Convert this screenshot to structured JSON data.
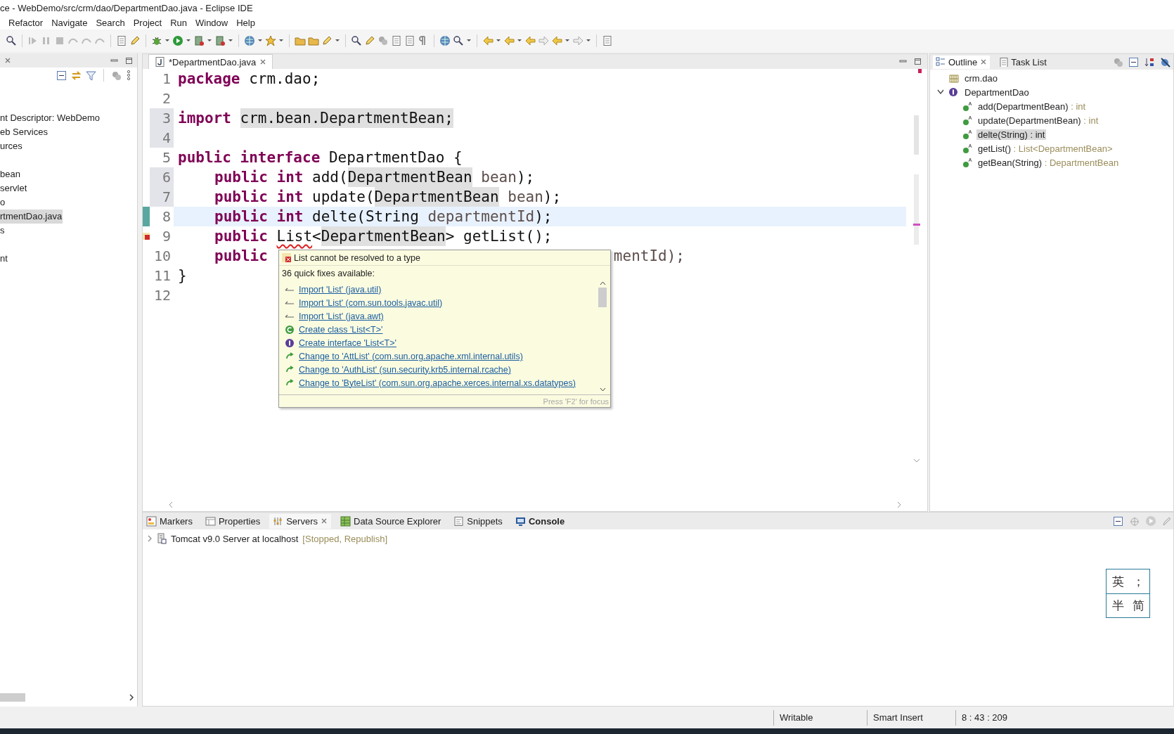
{
  "window": {
    "title": "ce - WebDemo/src/crm/dao/DepartmentDao.java - Eclipse IDE"
  },
  "menu": [
    "Refactor",
    "Navigate",
    "Search",
    "Project",
    "Run",
    "Window",
    "Help"
  ],
  "explorer": {
    "groups": [
      [
        {
          "label": "nt Descriptor: WebDemo",
          "selected": false
        },
        {
          "label": "eb Services",
          "selected": false
        },
        {
          "label": "urces",
          "selected": false
        }
      ],
      [
        {
          "label": "bean",
          "selected": false
        },
        {
          "label": "servlet",
          "selected": false
        },
        {
          "label": "o",
          "selected": false
        },
        {
          "label": "rtmentDao.java",
          "selected": true
        },
        {
          "label": "s",
          "selected": false
        }
      ],
      [
        {
          "label": "nt",
          "selected": false
        }
      ]
    ]
  },
  "editor": {
    "tab": {
      "label": "*DepartmentDao.java",
      "selected": true
    },
    "lines": [
      {
        "number": "1",
        "shaded": false,
        "tokens": [
          {
            "text": "package",
            "kind": "keyword"
          },
          {
            "text": " crm.dao;",
            "kind": "plain"
          }
        ]
      },
      {
        "number": "2",
        "shaded": false
      },
      {
        "number": "3",
        "shaded": true,
        "tokens": [
          {
            "text": "import ",
            "kind": "keyword"
          },
          {
            "text": "crm.bean.DepartmentBean;",
            "kind": "occurrence"
          }
        ]
      },
      {
        "number": "4",
        "shaded": true
      },
      {
        "number": "5",
        "shaded": false,
        "tokens": [
          {
            "text": "public",
            "kind": "keyword"
          },
          {
            "text": " interface",
            "kind": "keyword"
          },
          {
            "text": " DepartmentDao {",
            "kind": "plain"
          }
        ]
      },
      {
        "number": "6",
        "shaded": true,
        "indented": true,
        "tokens": [
          {
            "text": "public",
            "kind": "keyword"
          },
          {
            "text": " int",
            "kind": "keyword"
          },
          {
            "text": " add(",
            "kind": "plain"
          },
          {
            "text": "DepartmentBean",
            "kind": "occurrence"
          },
          {
            "text": " bean",
            "kind": "parameter"
          },
          {
            "text": ");",
            "kind": "plain"
          }
        ]
      },
      {
        "number": "7",
        "shaded": true,
        "indented": true,
        "tokens": [
          {
            "text": "public",
            "kind": "keyword"
          },
          {
            "text": " int",
            "kind": "keyword"
          },
          {
            "text": " update(",
            "kind": "plain"
          },
          {
            "text": "DepartmentBean",
            "kind": "occurrence"
          },
          {
            "text": " bean",
            "kind": "parameter"
          },
          {
            "text": ");",
            "kind": "plain"
          }
        ]
      },
      {
        "number": "8",
        "shaded": false,
        "current": true,
        "marker": {
          "kind": "change"
        },
        "indented": true,
        "tokens": [
          {
            "text": "public",
            "kind": "keyword"
          },
          {
            "text": " int",
            "kind": "keyword"
          },
          {
            "text": " delte(String ",
            "kind": "plain"
          },
          {
            "text": "departmentId",
            "kind": "parameter"
          },
          {
            "text": ");",
            "kind": "plain"
          }
        ]
      },
      {
        "number": "9",
        "shaded": false,
        "marker": {
          "kind": "error"
        },
        "indented": true,
        "tokens": [
          {
            "text": "public ",
            "kind": "keyword"
          },
          {
            "text": "List",
            "kind": "error"
          },
          {
            "text": "<",
            "kind": "plain"
          },
          {
            "text": "DepartmentBean",
            "kind": "occurrence"
          },
          {
            "text": "> getList();",
            "kind": "plain"
          }
        ]
      },
      {
        "number": "10",
        "shaded": false,
        "indented": true,
        "tokens": [
          {
            "text": "public",
            "kind": "keyword"
          },
          {
            "text": "mentId);",
            "kind": "tail"
          }
        ]
      },
      {
        "number": "11",
        "shaded": false,
        "tokens": [
          {
            "text": "}",
            "kind": "plain"
          }
        ]
      },
      {
        "number": "12",
        "shaded": false
      }
    ]
  },
  "quick_fix": {
    "title": "List cannot be resolved to a type",
    "summary": "36 quick fixes available:",
    "fixes": [
      {
        "kind": "import",
        "label": "Import 'List' (java.util)"
      },
      {
        "kind": "import",
        "label": "Import 'List' (com.sun.tools.javac.util)"
      },
      {
        "kind": "import",
        "label": "Import 'List' (java.awt)"
      },
      {
        "kind": "class",
        "label": "Create class 'List<T>'"
      },
      {
        "kind": "interface",
        "label": "Create interface 'List<T>'"
      },
      {
        "kind": "change",
        "label": "Change to 'AttList' (com.sun.org.apache.xml.internal.utils)"
      },
      {
        "kind": "change",
        "label": "Change to 'AuthList' (sun.security.krb5.internal.rcache)"
      },
      {
        "kind": "change",
        "label": "Change to 'ByteList' (com.sun.org.apache.xerces.internal.xs.datatypes)"
      }
    ],
    "footer": "Press 'F2' for focus"
  },
  "outline": {
    "tabs": [
      {
        "label": "Outline",
        "selected": true
      },
      {
        "label": "Task List",
        "selected": false
      }
    ],
    "tree": [
      {
        "kind": "package",
        "label": "crm.dao"
      },
      {
        "kind": "interface",
        "label": "DepartmentDao",
        "expanded": true,
        "children": [
          {
            "kind": "method",
            "label": "add(DepartmentBean)",
            "type": " : int",
            "selected": false
          },
          {
            "kind": "method",
            "label": "update(DepartmentBean)",
            "type": " : int",
            "selected": false
          },
          {
            "kind": "method",
            "label": "delte(String)",
            "type": " : int",
            "selected": true
          },
          {
            "kind": "method",
            "label": "getList()",
            "type": " : List<DepartmentBean>",
            "selected": false
          },
          {
            "kind": "method",
            "label": "getBean(String)",
            "type": " : DepartmentBean",
            "selected": false
          }
        ]
      }
    ]
  },
  "bottom_panel": {
    "tabs": [
      {
        "kind": "markers",
        "label": "Markers",
        "selected": false,
        "bold": false
      },
      {
        "kind": "properties",
        "label": "Properties",
        "selected": false,
        "bold": false
      },
      {
        "kind": "servers",
        "label": "Servers",
        "selected": true,
        "bold": false
      },
      {
        "kind": "datasource",
        "label": "Data Source Explorer",
        "selected": false,
        "bold": false
      },
      {
        "kind": "snippets",
        "label": "Snippets",
        "selected": false,
        "bold": false
      },
      {
        "kind": "console",
        "label": "Console",
        "selected": false,
        "bold": true
      }
    ],
    "servers": [
      {
        "name": "Tomcat v9.0 Server at localhost",
        "state": "[Stopped, Republish]",
        "expanded": false
      }
    ]
  },
  "ime": [
    [
      "英",
      "；"
    ],
    [
      "半",
      "简"
    ]
  ],
  "status_bar": [
    "Writable",
    "Smart Insert",
    "8 : 43 : 209"
  ]
}
